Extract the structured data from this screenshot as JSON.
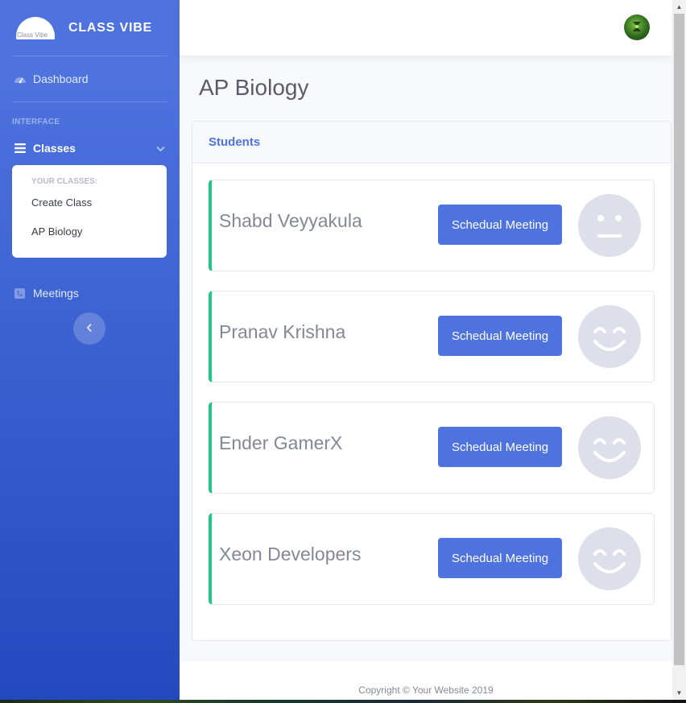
{
  "brand": {
    "name": "CLASS VIBE",
    "logo_text": "Class Vibe"
  },
  "sidebar": {
    "dashboard_label": "Dashboard",
    "heading_interface": "INTERFACE",
    "classes_label": "Classes",
    "classes_submenu": {
      "header": "YOUR CLASSES:",
      "items": [
        {
          "label": "Create Class"
        },
        {
          "label": "AP Biology"
        }
      ]
    },
    "meetings_label": "Meetings"
  },
  "page": {
    "title": "AP Biology"
  },
  "students_card": {
    "header": "Students",
    "button_label": "Schedual Meeting",
    "students": [
      {
        "name": "Shabd Veyyakula",
        "face_icon": "neutral-face-icon"
      },
      {
        "name": "Pranav Krishna",
        "face_icon": "smiling-face-icon"
      },
      {
        "name": "Ender GamerX",
        "face_icon": "smiling-face-icon"
      },
      {
        "name": "Xeon Developers",
        "face_icon": "smiling-face-icon"
      }
    ]
  },
  "footer": {
    "copyright": "Copyright © Your Website 2019"
  },
  "colors": {
    "primary": "#4e73df",
    "success_border": "#1cc88a",
    "sidebar_gradient_start": "#4e73df",
    "sidebar_gradient_end": "#224abe"
  }
}
